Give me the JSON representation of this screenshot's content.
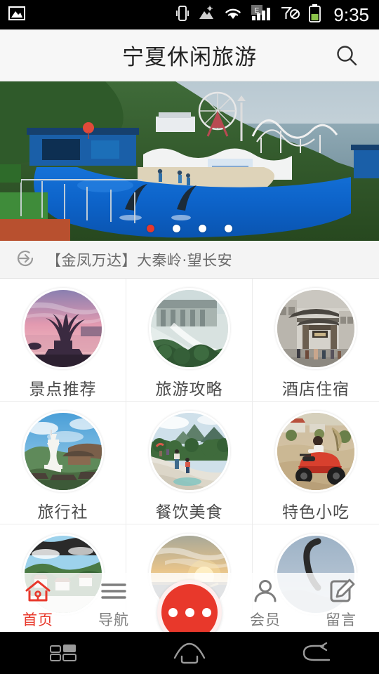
{
  "status_bar": {
    "time": "9:35",
    "icons": [
      "image-icon",
      "vibrate-icon",
      "photo-icon",
      "wifi-icon",
      "signal-e-icon",
      "no-sim-icon",
      "battery-icon"
    ]
  },
  "header": {
    "title": "宁夏休闲旅游",
    "search_icon": "search-icon"
  },
  "banner": {
    "alt": "海洋公园海豚表演",
    "dot_count": 4,
    "active_dot": 0,
    "active_color": "#e8382b"
  },
  "ticker": {
    "icon": "refresh-arrow-icon",
    "text": "【金凤万达】大秦岭·望长安"
  },
  "grid": {
    "items": [
      {
        "label": "景点推荐",
        "thumb": "sunset-sculpture-thumb"
      },
      {
        "label": "旅游攻略",
        "thumb": "dam-waterfall-thumb"
      },
      {
        "label": "酒店住宿",
        "thumb": "chinese-gateway-thumb"
      },
      {
        "label": "旅行社",
        "thumb": "white-pagoda-thumb"
      },
      {
        "label": "餐饮美食",
        "thumb": "river-valley-thumb"
      },
      {
        "label": "特色小吃",
        "thumb": "atv-desert-thumb"
      },
      {
        "label": "",
        "thumb": "mountain-village-thumb"
      },
      {
        "label": "",
        "thumb": "sunset-sea-thumb"
      },
      {
        "label": "",
        "thumb": "desert-curve-thumb"
      }
    ]
  },
  "tabbar": {
    "active_color": "#e8382b",
    "inactive_color": "#7d7d7d",
    "tabs": [
      {
        "label": "首页",
        "icon": "home-icon",
        "active": true
      },
      {
        "label": "导航",
        "icon": "menu-icon",
        "active": false
      },
      {
        "label": "会员",
        "icon": "person-icon",
        "active": false
      },
      {
        "label": "留言",
        "icon": "compose-icon",
        "active": false
      }
    ],
    "fab": {
      "icon": "more-dots-icon",
      "color": "#e8382b",
      "dots": 3
    }
  },
  "android_nav": {
    "buttons": [
      "recents-icon",
      "home-icon",
      "back-icon"
    ]
  }
}
